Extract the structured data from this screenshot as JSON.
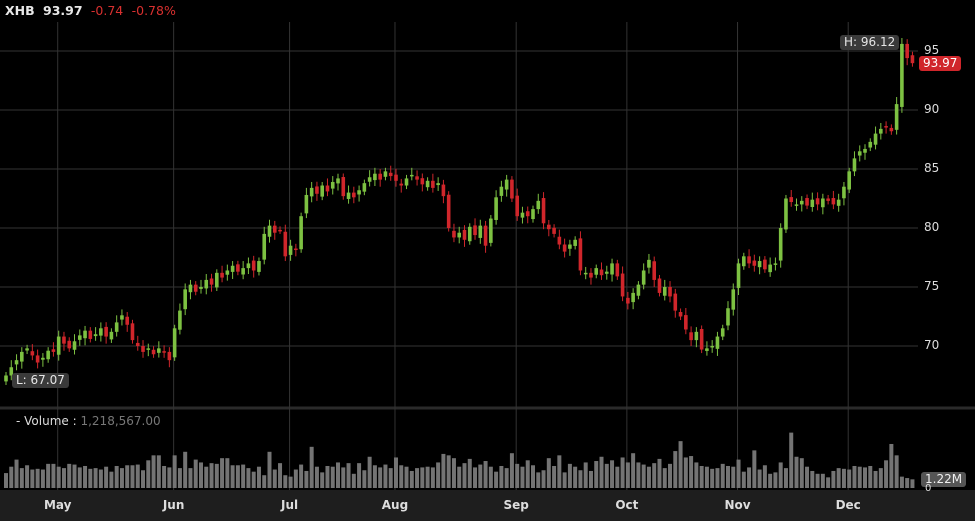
{
  "header": {
    "symbol": "XHB",
    "last": "93.97",
    "change": "-0.74",
    "change_pct": "-0.78%"
  },
  "price_labels": {
    "high": "H: 96.12",
    "low": "L: 67.07",
    "last_tag": "93.97"
  },
  "volume": {
    "title": "- Volume :",
    "value": "1,218,567.00",
    "last_tag": "1.22M",
    "zero": "0"
  },
  "colors": {
    "up": "#7dc142",
    "down": "#d0262b",
    "volume": "#747474",
    "grid": "#333333",
    "bg": "#000000"
  },
  "chart_data": {
    "type": "candlestick",
    "ylim": [
      66,
      97
    ],
    "y_ticks": [
      "95",
      "90",
      "85",
      "80",
      "75",
      "70"
    ],
    "y_tick_values": [
      95,
      90,
      85,
      80,
      75,
      70
    ],
    "x_labels": [
      "May",
      "Jun",
      "Jul",
      "Aug",
      "Sep",
      "Oct",
      "Nov",
      "Dec"
    ],
    "x_label_index": [
      10,
      32,
      54,
      74,
      97,
      118,
      139,
      160
    ],
    "closes": [
      67.5,
      68.2,
      68.8,
      69.5,
      69.8,
      69.2,
      68.6,
      69.0,
      69.6,
      69.5,
      70.8,
      70.2,
      69.8,
      70.4,
      70.9,
      71.3,
      70.6,
      71.0,
      71.5,
      70.8,
      71.2,
      72.0,
      72.6,
      71.8,
      70.5,
      70.0,
      69.5,
      69.8,
      69.3,
      69.8,
      69.5,
      68.8,
      71.5,
      73.0,
      74.8,
      75.2,
      74.6,
      75.0,
      75.6,
      75.2,
      76.2,
      75.8,
      76.4,
      76.8,
      76.3,
      76.6,
      77.0,
      76.4,
      77.2,
      79.5,
      80.2,
      79.6,
      79.8,
      77.6,
      78.5,
      78.2,
      81.0,
      82.8,
      83.4,
      82.9,
      83.6,
      83.1,
      83.9,
      84.2,
      82.7,
      83.0,
      82.6,
      83.2,
      83.8,
      84.3,
      84.6,
      84.1,
      84.8,
      84.4,
      84.0,
      83.6,
      84.2,
      84.5,
      84.1,
      83.7,
      84.0,
      83.4,
      83.8,
      82.7,
      80.0,
      79.2,
      79.6,
      79.0,
      80.1,
      79.4,
      80.2,
      78.5,
      80.8,
      82.6,
      83.5,
      84.1,
      82.5,
      81.0,
      81.3,
      81.0,
      81.6,
      82.3,
      80.4,
      79.9,
      79.5,
      78.6,
      78.0,
      78.6,
      79.0,
      76.4,
      76.2,
      75.8,
      76.6,
      76.0,
      76.3,
      77.0,
      75.9,
      74.2,
      73.6,
      74.5,
      75.2,
      76.4,
      77.3,
      75.6,
      74.5,
      75.0,
      74.2,
      73.0,
      72.5,
      71.4,
      70.5,
      71.2,
      69.7,
      69.8,
      70.0,
      70.8,
      71.5,
      73.2,
      74.8,
      77.0,
      77.6,
      77.0,
      76.8,
      77.2,
      76.5,
      76.9,
      77.0,
      80.0,
      82.5,
      82.2,
      82.0,
      82.3,
      81.9,
      82.4,
      82.0,
      82.5,
      82.3,
      82.0,
      82.4,
      83.5,
      84.8,
      85.9,
      86.5,
      86.7,
      87.3,
      88.0,
      88.4,
      88.6,
      88.2,
      90.5,
      95.6,
      94.4,
      93.97
    ],
    "volumes_m": [
      2.1,
      3.0,
      4.0,
      2.8,
      3.2,
      2.6,
      2.7,
      2.6,
      3.4,
      3.4,
      3.0,
      2.8,
      3.4,
      3.3,
      2.9,
      3.1,
      2.7,
      2.8,
      2.6,
      3.0,
      2.3,
      3.1,
      2.8,
      3.2,
      3.2,
      3.3,
      2.5,
      3.9,
      4.6,
      4.6,
      3.1,
      2.9,
      4.6,
      2.8,
      5.1,
      2.8,
      4.0,
      3.6,
      3.0,
      3.5,
      3.4,
      4.2,
      4.2,
      3.2,
      3.2,
      3.3,
      2.8,
      2.3,
      3.0,
      1.8,
      5.1,
      2.6,
      3.5,
      1.8,
      1.6,
      2.6,
      3.3,
      2.4,
      5.8,
      3.0,
      2.2,
      3.1,
      3.0,
      3.6,
      2.9,
      3.5,
      2.0,
      3.5,
      2.5,
      4.4,
      3.2,
      2.9,
      3.3,
      2.8,
      4.3,
      3.2,
      3.0,
      2.4,
      2.8,
      2.9,
      3.0,
      2.9,
      3.6,
      4.8,
      4.6,
      4.2,
      3.0,
      3.5,
      4.1,
      2.9,
      3.3,
      3.8,
      3.0,
      2.3,
      3.1,
      2.8,
      4.9,
      3.4,
      3.0,
      3.9,
      3.2,
      2.2,
      2.5,
      4.2,
      3.1,
      4.6,
      2.2,
      3.4,
      3.0,
      2.5,
      3.6,
      2.4,
      3.8,
      4.4,
      3.4,
      3.9,
      3.0,
      4.3,
      3.6,
      4.9,
      3.6,
      3.3,
      3.0,
      3.5,
      4.1,
      2.8,
      3.4,
      5.2,
      6.6,
      4.3,
      4.5,
      3.6,
      3.1,
      3.0,
      2.7,
      2.8,
      3.4,
      3.1,
      3.0,
      4.0,
      2.3,
      2.9,
      5.3,
      2.6,
      3.2,
      2.0,
      2.2,
      3.6,
      2.8,
      7.8,
      4.4,
      4.2,
      3.0,
      2.4,
      2.0,
      2.0,
      1.5,
      2.4,
      2.8,
      2.7,
      2.6,
      3.1,
      3.0,
      2.9,
      3.1,
      2.4,
      2.8,
      3.9,
      6.2,
      4.6,
      1.6,
      1.4,
      1.22
    ]
  }
}
